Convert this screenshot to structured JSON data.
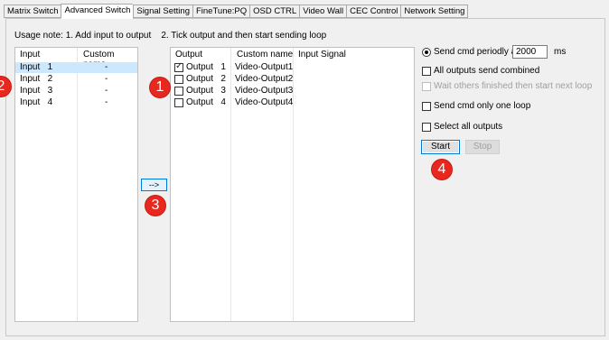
{
  "tabs": [
    {
      "label": "Matrix Switch",
      "active": false
    },
    {
      "label": "Advanced Switch",
      "active": true
    },
    {
      "label": "Signal Setting",
      "active": false
    },
    {
      "label": "FineTune:PQ",
      "active": false
    },
    {
      "label": "OSD CTRL",
      "active": false
    },
    {
      "label": "Video Wall",
      "active": false
    },
    {
      "label": "CEC Control",
      "active": false
    },
    {
      "label": "Network Setting",
      "active": false
    }
  ],
  "usage_note": "Usage note: 1. Add input to output    2. Tick output and then start sending loop",
  "input_list": {
    "headers": {
      "input": "Input",
      "custom_name": "Custom name"
    },
    "rows": [
      {
        "input": "Input   1",
        "custom_name": "-",
        "selected": true
      },
      {
        "input": "Input   2",
        "custom_name": "-",
        "selected": false
      },
      {
        "input": "Input   3",
        "custom_name": "-",
        "selected": false
      },
      {
        "input": "Input   4",
        "custom_name": "-",
        "selected": false
      }
    ]
  },
  "add_button_label": "-->",
  "output_list": {
    "headers": {
      "output": "Output",
      "custom_name": "Custom name",
      "input_signal": "Input Signal"
    },
    "rows": [
      {
        "output": "Output   1",
        "custom_name": "Video-Output1",
        "input_signal": "",
        "checked": true
      },
      {
        "output": "Output   2",
        "custom_name": "Video-Output2",
        "input_signal": "",
        "checked": false
      },
      {
        "output": "Output   3",
        "custom_name": "Video-Output3",
        "input_signal": "",
        "checked": false
      },
      {
        "output": "Output   4",
        "custom_name": "Video-Output4",
        "input_signal": "",
        "checked": false
      }
    ]
  },
  "options": {
    "send_periodic_label": "Send cmd periodly at",
    "period_value": "2000",
    "period_unit": "ms",
    "all_outputs_combined": "All outputs send combined",
    "wait_others": "Wait others finished then start next loop",
    "one_loop": "Send cmd only one loop",
    "select_all": "Select all outputs"
  },
  "buttons": {
    "start": "Start",
    "stop": "Stop"
  },
  "badges": {
    "b1": "1",
    "b2": "2",
    "b3": "3",
    "b4": "4"
  },
  "colors": {
    "badge": "#e8281e",
    "selection": "#cce8ff",
    "focus_border": "#0078d7"
  }
}
